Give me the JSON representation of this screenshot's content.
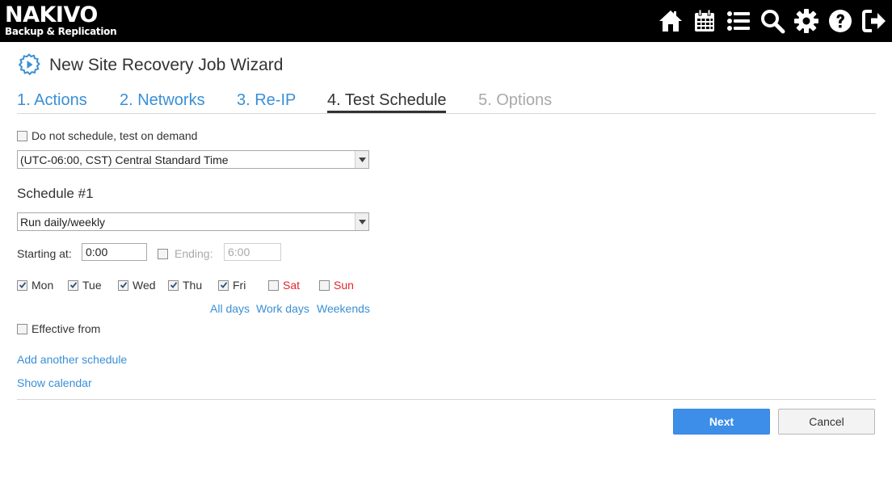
{
  "brand": {
    "name": "NAKIVO",
    "subtitle": "Backup & Replication"
  },
  "toolbar": {
    "icons": [
      "home-icon",
      "calendar-icon",
      "list-icon",
      "search-icon",
      "gear-icon",
      "help-icon",
      "logout-icon"
    ]
  },
  "wizard": {
    "title": "New Site Recovery Job Wizard",
    "tabs": [
      {
        "label": "1. Actions",
        "state": "link"
      },
      {
        "label": "2. Networks",
        "state": "link"
      },
      {
        "label": "3. Re-IP",
        "state": "link"
      },
      {
        "label": "4. Test Schedule",
        "state": "active"
      },
      {
        "label": "5. Options",
        "state": "disabled"
      }
    ]
  },
  "schedule_form": {
    "no_schedule_label": "Do not schedule, test on demand",
    "no_schedule_checked": false,
    "timezone_value": "(UTC-06:00, CST) Central Standard Time",
    "schedule_heading": "Schedule #1",
    "frequency_value": "Run daily/weekly",
    "starting_label": "Starting at:",
    "starting_value": "0:00",
    "ending_label": "Ending:",
    "ending_value": "6:00",
    "ending_checked": false,
    "days": [
      {
        "label": "Mon",
        "checked": true,
        "weekend": false
      },
      {
        "label": "Tue",
        "checked": true,
        "weekend": false
      },
      {
        "label": "Wed",
        "checked": true,
        "weekend": false
      },
      {
        "label": "Thu",
        "checked": true,
        "weekend": false
      },
      {
        "label": "Fri",
        "checked": true,
        "weekend": false
      },
      {
        "label": "Sat",
        "checked": false,
        "weekend": true
      },
      {
        "label": "Sun",
        "checked": false,
        "weekend": true
      }
    ],
    "day_presets": {
      "all_days": "All days",
      "work_days": "Work days",
      "weekends": "Weekends"
    },
    "effective_from_label": "Effective from",
    "effective_from_checked": false,
    "add_schedule_link": "Add another schedule",
    "show_calendar_link": "Show calendar"
  },
  "footer": {
    "next_label": "Next",
    "cancel_label": "Cancel"
  },
  "colors": {
    "topbar": "#000000",
    "link": "#3a8fd6",
    "primary_button": "#3d8ee8",
    "weekend": "#e0262c",
    "disabled": "#a9a9a9"
  }
}
